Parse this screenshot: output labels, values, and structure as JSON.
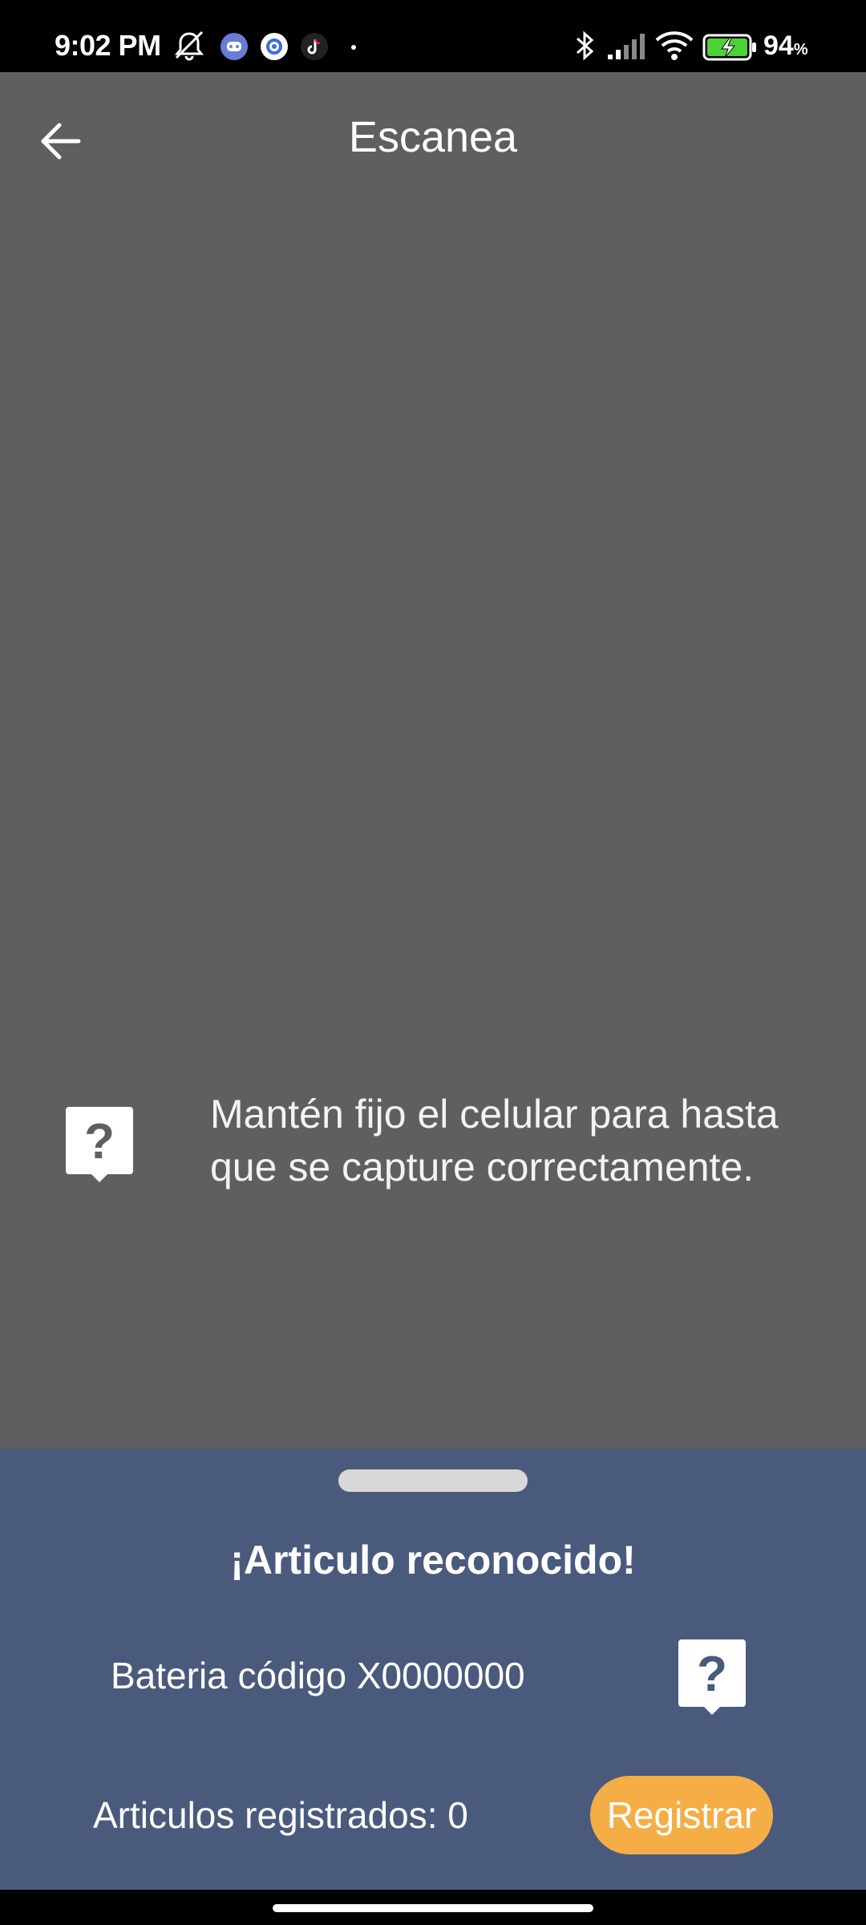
{
  "status_bar": {
    "time": "9:02 PM",
    "battery_percent": "94",
    "battery_unit": "%",
    "icons": [
      "mute-icon",
      "discord-icon",
      "settings-app-icon",
      "tiktok-icon",
      "dot-icon",
      "bluetooth-icon",
      "signal-icon",
      "wifi-icon",
      "battery-charging-icon"
    ],
    "battery_color": "#4cd137"
  },
  "app_bar": {
    "title": "Escanea",
    "back_icon": "arrow-left-icon"
  },
  "hint": {
    "icon": "help-icon",
    "text": "Mantén fijo el celular para hasta que se capture correctamente."
  },
  "sheet": {
    "title": "¡Articulo reconocido!",
    "item_label": "Bateria código X0000000",
    "item_icon": "help-icon",
    "count_label": "Articulos registrados: 0",
    "register_label": "Registrar"
  },
  "colors": {
    "camera_background": "#5e5f60",
    "sheet_background": "#4a5a7d",
    "accent": "#f4ae45"
  }
}
